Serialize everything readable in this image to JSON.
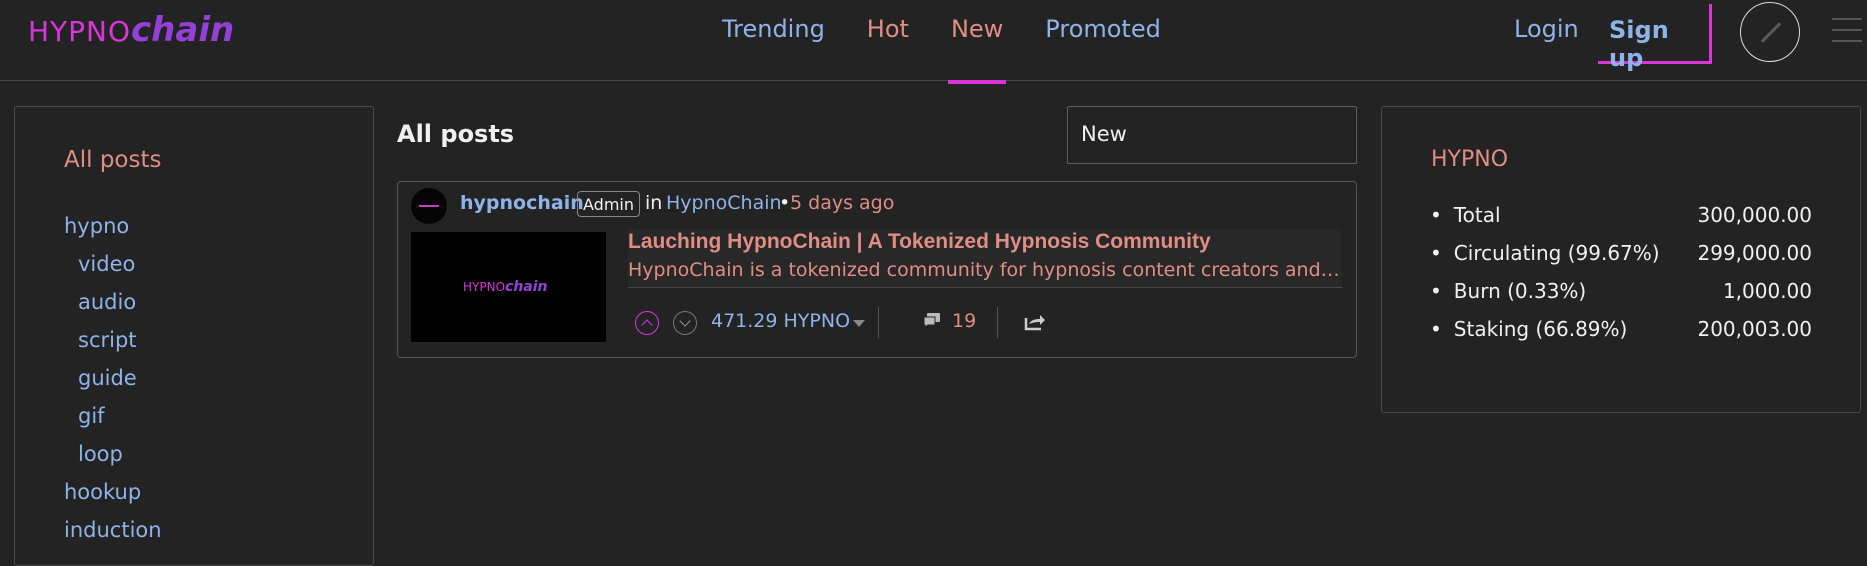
{
  "brand": {
    "logo_part1": "HYPNO",
    "logo_part2": "chain"
  },
  "nav": {
    "tabs": [
      "Trending",
      "Hot",
      "New",
      "Promoted"
    ],
    "active": "New"
  },
  "auth": {
    "login": "Login",
    "signup": "Sign up"
  },
  "sidebar": {
    "heading": "All posts",
    "tags": [
      "hypno",
      "video",
      "audio",
      "script",
      "guide",
      "gif",
      "loop",
      "hookup",
      "induction"
    ]
  },
  "feed": {
    "title": "All posts",
    "sort_value": "New"
  },
  "post": {
    "author": "hypnochain",
    "badge": "Admin",
    "in_label": "in",
    "community": "HypnoChain",
    "dot": "•",
    "time": "5 days ago",
    "thumb_logo_part1": "HYPNO",
    "thumb_logo_part2": "chain",
    "title": "Lauching HypnoChain | A Tokenized Hypnosis Community",
    "summary": "HypnoChain is a tokenized community for hypnosis content creators and app…",
    "payout": "471.29 HYPNO",
    "comments": "19"
  },
  "token": {
    "title": "HYPNO",
    "stats": [
      {
        "label": "Total",
        "value": "300,000.00"
      },
      {
        "label": "Circulating (99.67%)",
        "value": "299,000.00"
      },
      {
        "label": "Burn (0.33%)",
        "value": "1,000.00"
      },
      {
        "label": "Staking (66.89%)",
        "value": "200,003.00"
      }
    ]
  },
  "colors": {
    "accent": "#d935d9",
    "link": "#8eb3e8",
    "salmon": "#e08d84",
    "background": "#232323"
  }
}
